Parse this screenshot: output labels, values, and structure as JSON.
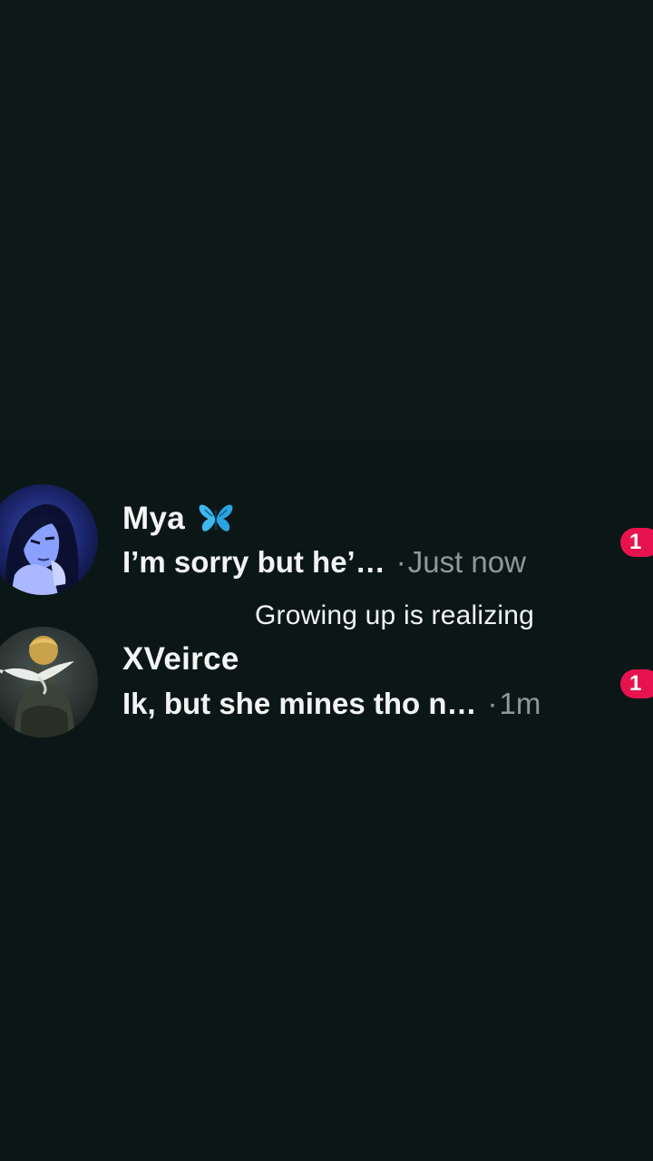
{
  "conversations": [
    {
      "name": "Mya",
      "name_icon": "butterfly-icon",
      "preview": "I’m sorry but he’…",
      "separator": "·",
      "time": "Just now",
      "unread_count": "1",
      "avatar_icon": "anime-girl-avatar"
    },
    {
      "name": "XVeirce",
      "preview": "Ik, but she mines tho n…",
      "separator": "·",
      "time": "1m",
      "unread_count": "1",
      "avatar_icon": "bird-statue-avatar"
    }
  ],
  "caption": "Growing up is realizing",
  "colors": {
    "background": "#0c1716",
    "badge": "#e6134f",
    "muted_text": "#8f9998",
    "butterfly": "#3fb7ef"
  }
}
